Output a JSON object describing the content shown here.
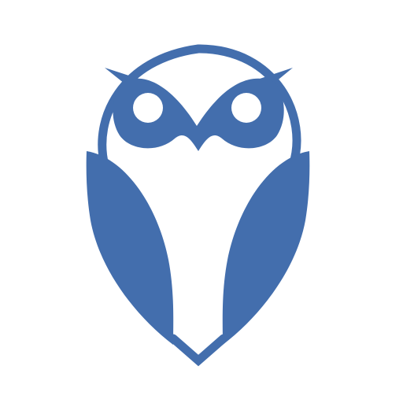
{
  "logo": {
    "name": "owl-logo",
    "primary_color": "#436ead",
    "background_color": "#ffffff"
  }
}
